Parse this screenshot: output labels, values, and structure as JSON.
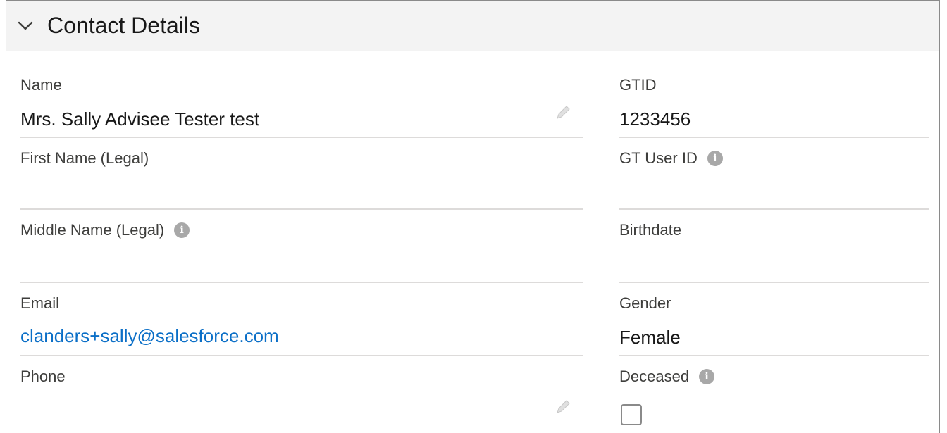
{
  "section": {
    "title": "Contact Details"
  },
  "left_fields": [
    {
      "label": "Name",
      "value": "Mrs. Sally Advisee Tester test"
    },
    {
      "label": "First Name (Legal)",
      "value": ""
    },
    {
      "label": "Middle Name (Legal)",
      "value": ""
    },
    {
      "label": "Email",
      "value": "clanders+sally@salesforce.com"
    },
    {
      "label": "Phone",
      "value": ""
    }
  ],
  "right_fields": [
    {
      "label": "GTID",
      "value": "1233456"
    },
    {
      "label": "GT User ID",
      "value": ""
    },
    {
      "label": "Birthdate",
      "value": ""
    },
    {
      "label": "Gender",
      "value": "Female"
    },
    {
      "label": "Deceased",
      "checked": false
    }
  ],
  "colors": {
    "link": "#0b6fc7",
    "header_bg": "#f3f3f3",
    "info_icon": "#a8a8a8"
  },
  "icons": [
    "chevron-down-icon",
    "pencil-edit-icon",
    "info-icon"
  ]
}
